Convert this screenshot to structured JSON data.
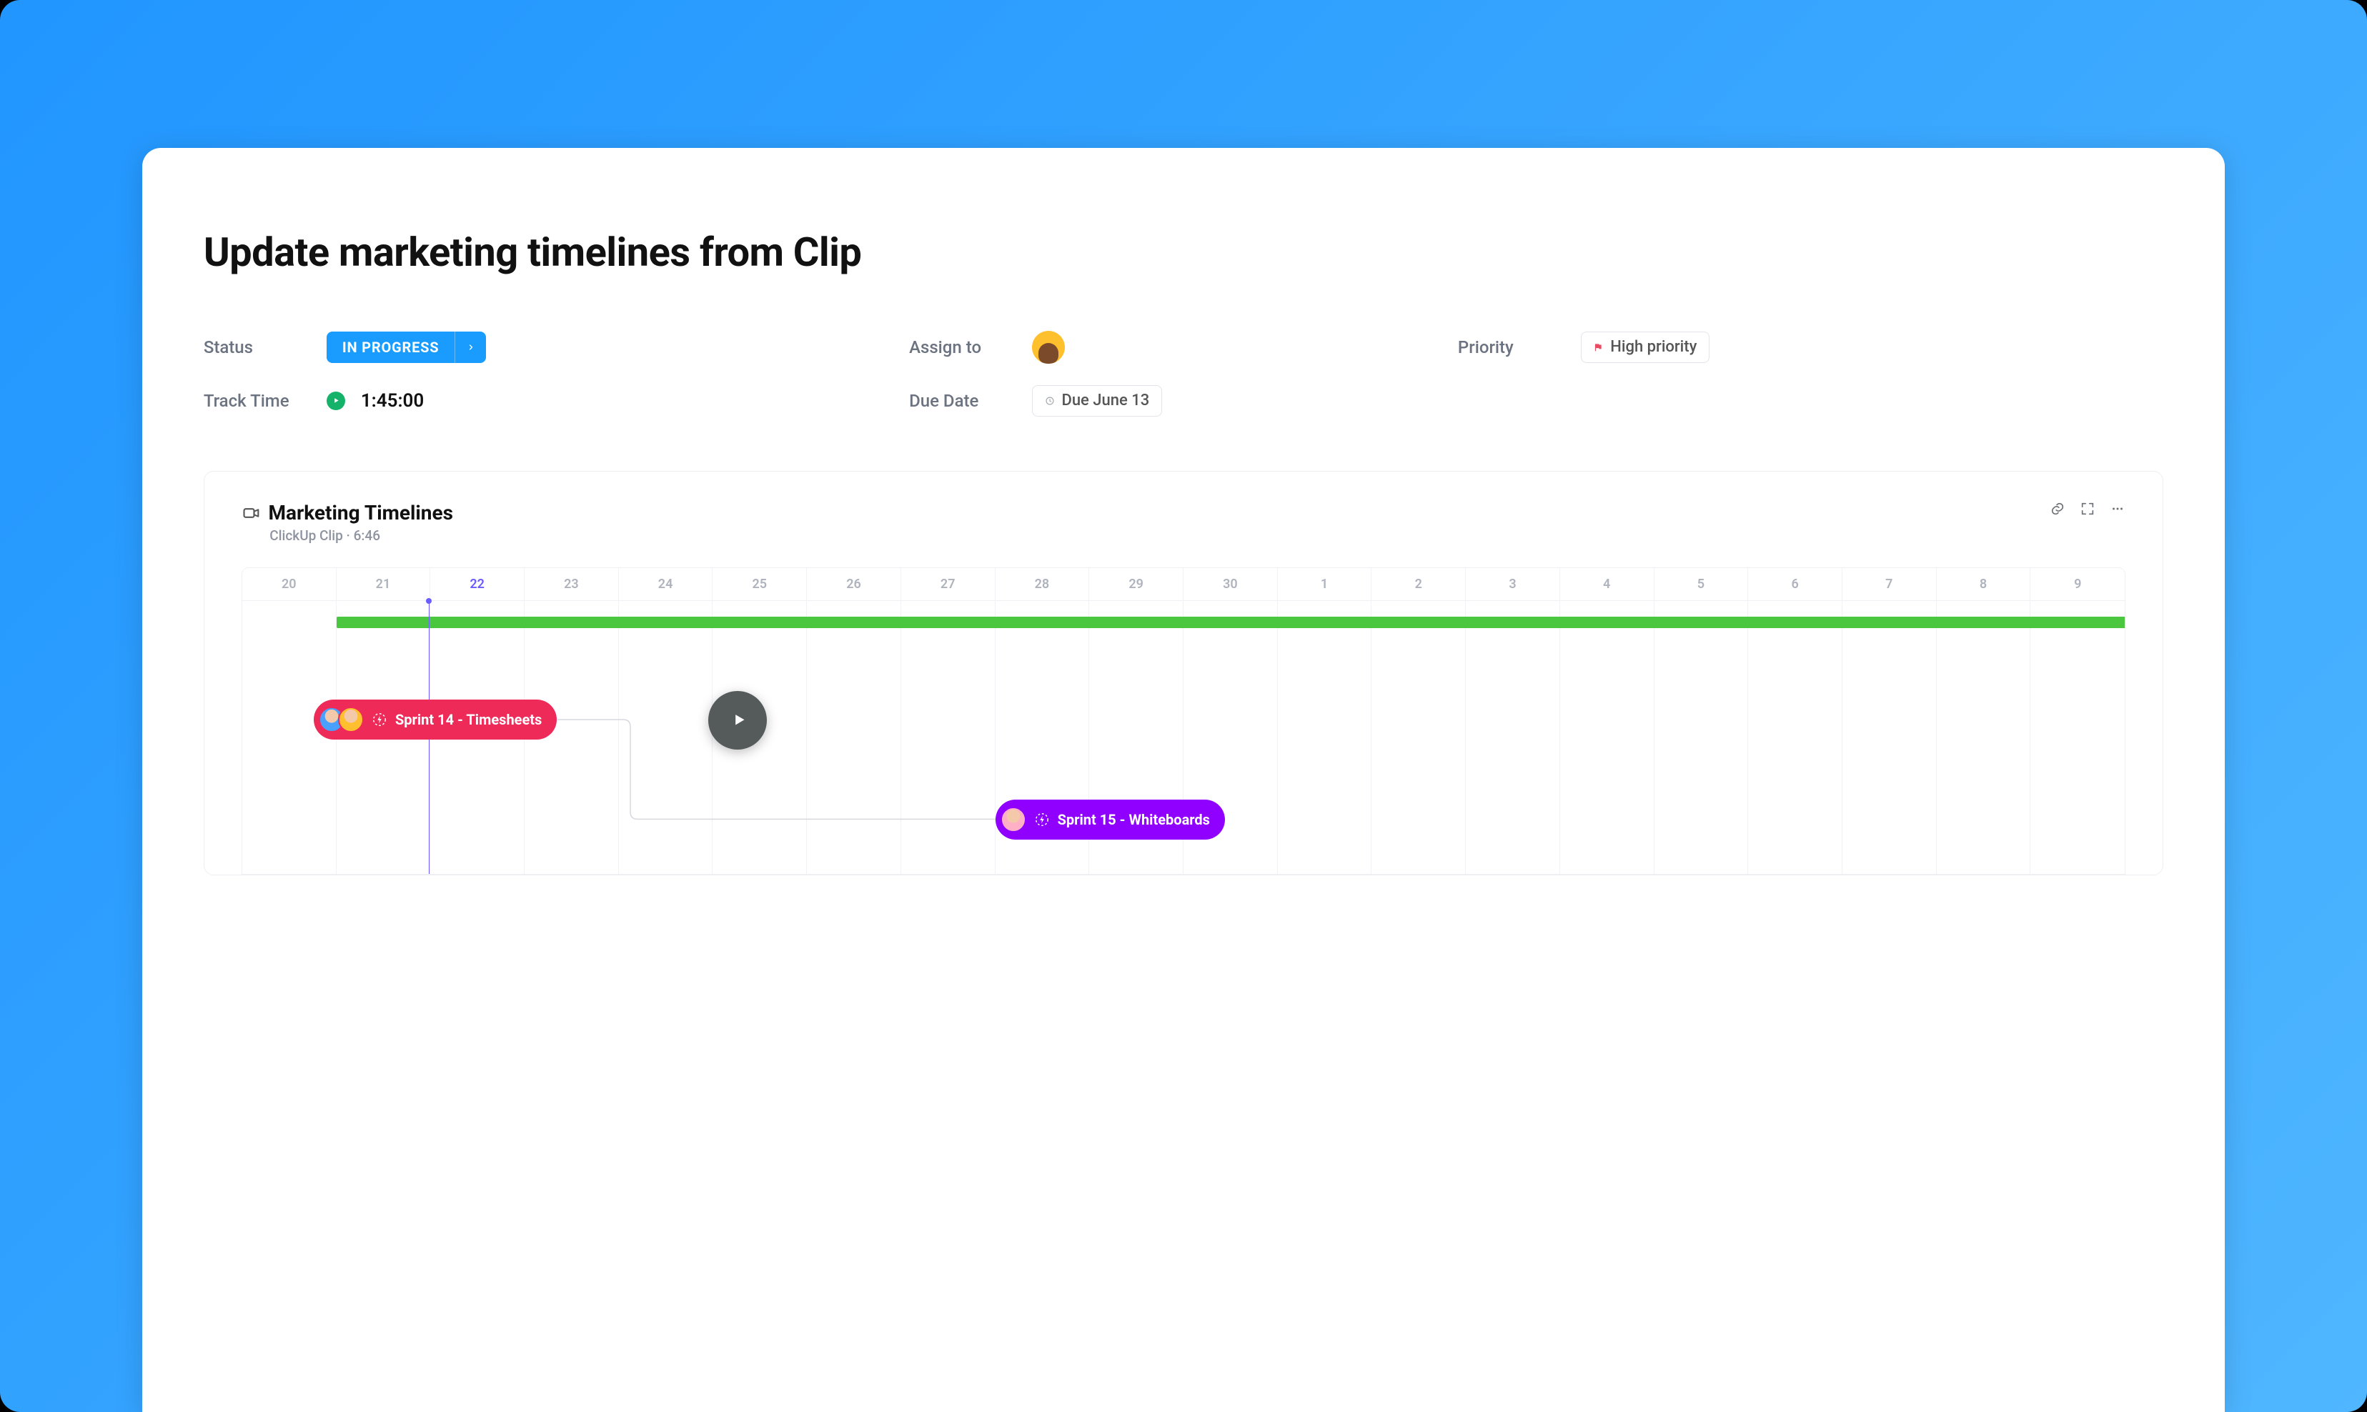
{
  "title": "Update marketing timelines from Clip",
  "fields": {
    "status_label": "Status",
    "track_time_label": "Track Time",
    "assign_to_label": "Assign to",
    "due_date_label": "Due Date",
    "priority_label": "Priority"
  },
  "status": {
    "text": "IN PROGRESS"
  },
  "track_time": {
    "value": "1:45:00"
  },
  "due_date": {
    "text": "Due June 13"
  },
  "priority": {
    "text": "High priority"
  },
  "clip": {
    "title": "Marketing Timelines",
    "subtitle": "ClickUp Clip · 6:46"
  },
  "timeline": {
    "dates": [
      "20",
      "21",
      "22",
      "23",
      "24",
      "25",
      "26",
      "27",
      "28",
      "29",
      "30",
      "1",
      "2",
      "3",
      "4",
      "5",
      "6",
      "7",
      "8",
      "9"
    ],
    "current_index": 2,
    "today_pos_pct": 9.9,
    "sprints": {
      "s14": "Sprint 14 - Timesheets",
      "s15": "Sprint 15 - Whiteboards"
    }
  }
}
